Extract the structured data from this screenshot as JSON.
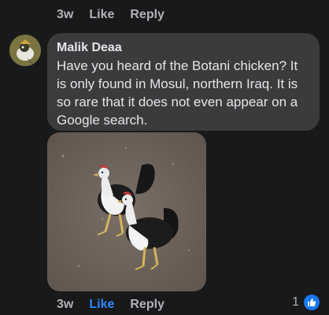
{
  "previous_comment": {
    "time": "3w",
    "like_label": "Like",
    "reply_label": "Reply"
  },
  "comment": {
    "author": "Malik Deaa",
    "text": "Have you heard of the Botani chicken? It is only found in Mosul, northern Iraq. It is so rare that it does not even appear on a Google search.",
    "time": "3w",
    "like_label": "Like",
    "reply_label": "Reply",
    "reaction_count": "1",
    "liked_color": "#2e89ff"
  },
  "icons": {
    "reaction": "thumbs-up-icon",
    "avatar": "avatar"
  }
}
